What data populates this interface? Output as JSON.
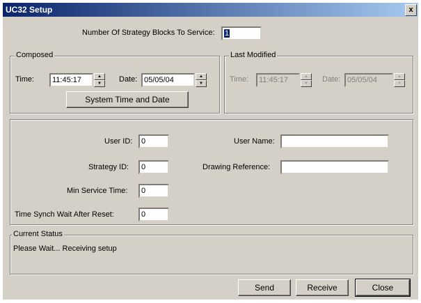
{
  "window": {
    "title": "UC32 Setup",
    "close_glyph": "x"
  },
  "strategy_blocks": {
    "label": "Number Of Strategy Blocks To Service:",
    "value": "1"
  },
  "composed": {
    "legend": "Composed",
    "time_label": "Time:",
    "time_value": "11:45:17",
    "date_label": "Date:",
    "date_value": "05/05/04",
    "system_button": "System Time and Date"
  },
  "last_modified": {
    "legend": "Last Modified",
    "time_label": "Time:",
    "time_value": "11:45:17",
    "date_label": "Date:",
    "date_value": "05/05/04"
  },
  "fields": {
    "user_id_label": "User ID:",
    "user_id_value": "0",
    "strategy_id_label": "Strategy ID:",
    "strategy_id_value": "0",
    "min_service_label": "Min Service Time:",
    "min_service_value": "0",
    "time_synch_label": "Time Synch Wait After Reset:",
    "time_synch_value": "0",
    "user_name_label": "User Name:",
    "user_name_value": "",
    "drawing_ref_label": "Drawing Reference:",
    "drawing_ref_value": ""
  },
  "status": {
    "legend": "Current Status",
    "text": "Please Wait... Receiving setup"
  },
  "buttons": {
    "send": "Send",
    "receive": "Receive",
    "close": "Close"
  },
  "spinner": {
    "up": "▲",
    "down": "▼"
  }
}
